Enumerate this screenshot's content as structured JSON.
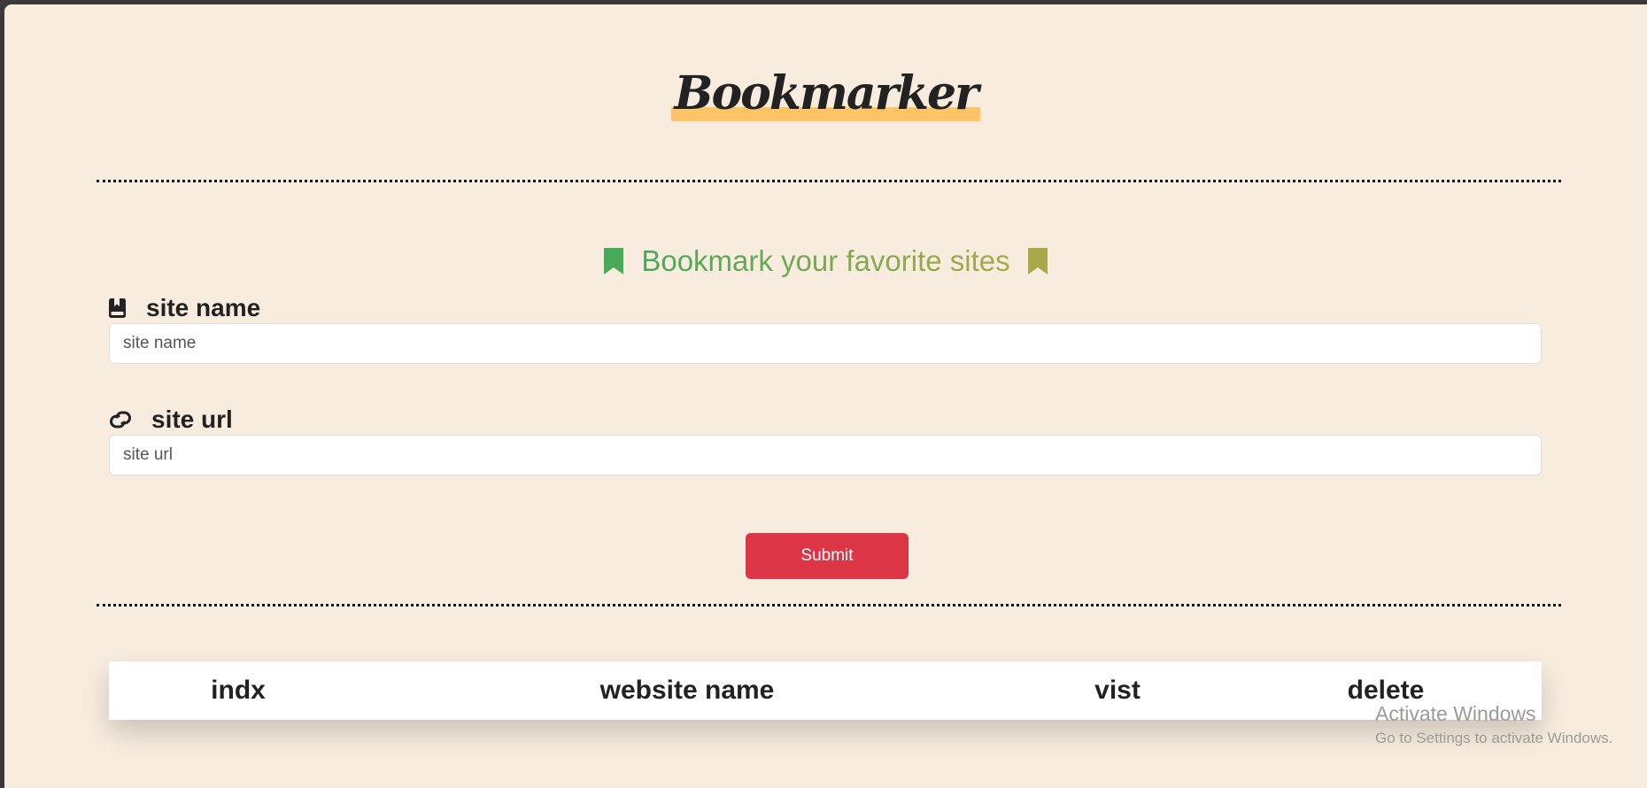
{
  "header": {
    "logo_text": "Bookmarker",
    "logo_highlight_color": "#ffc466"
  },
  "form": {
    "title": "Bookmark your favorite sites",
    "title_icon": "bookmark-icon",
    "title_gradient": [
      "#48a958",
      "#aaa94a"
    ],
    "site_name": {
      "label": "site name",
      "icon": "book-bookmark-icon",
      "placeholder": "site name",
      "value": ""
    },
    "site_url": {
      "label": "site url",
      "icon": "link-icon",
      "placeholder": "site url",
      "value": ""
    },
    "submit_label": "Submit",
    "submit_color": "#dc3545"
  },
  "table": {
    "columns": [
      "indx",
      "website name",
      "vist",
      "delete"
    ],
    "rows": []
  },
  "watermark": {
    "line1": "Activate Windows",
    "line2": "Go to Settings to activate Windows."
  },
  "colors": {
    "background": "#f8ecdf",
    "text": "#222222"
  }
}
